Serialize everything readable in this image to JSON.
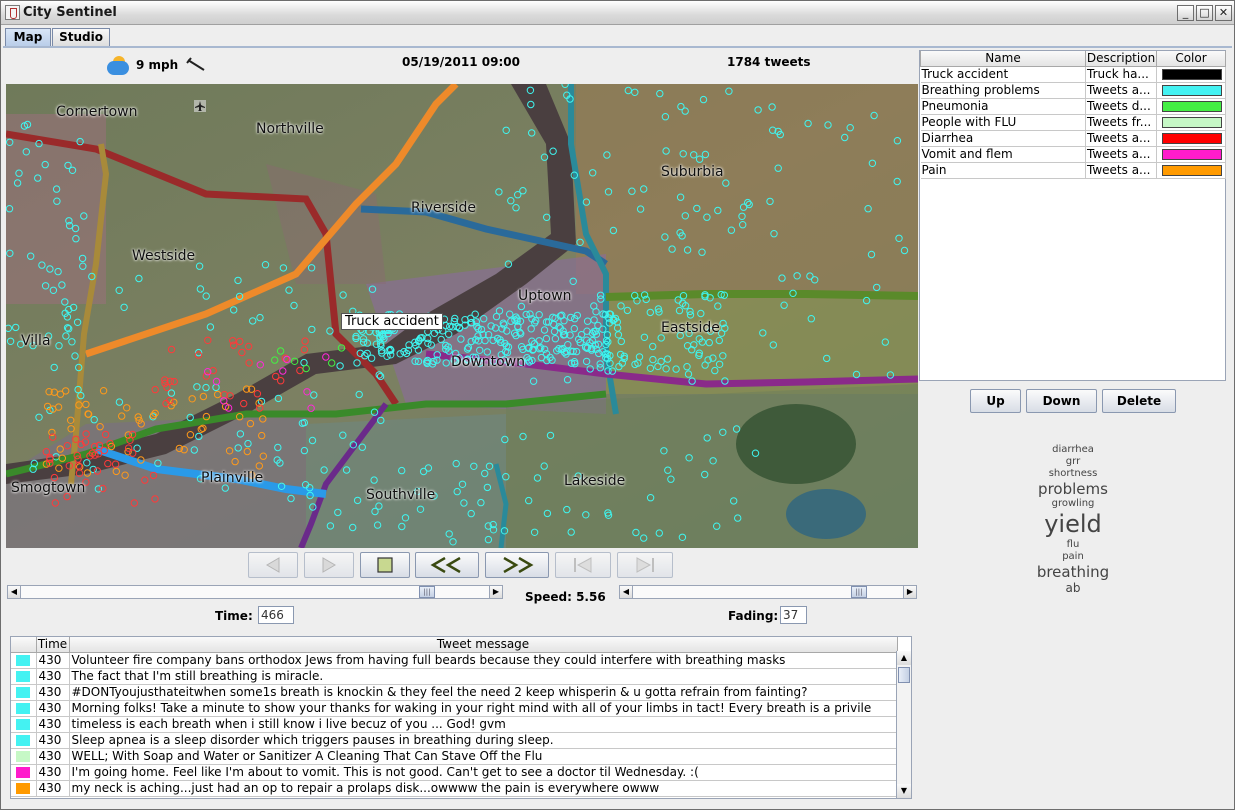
{
  "window": {
    "title": "City Sentinel"
  },
  "tabs": [
    {
      "label": "Map"
    },
    {
      "label": "Studio"
    }
  ],
  "status": {
    "wind": "9 mph",
    "datetime": "05/19/2011 09:00",
    "tweets": "1784 tweets"
  },
  "map": {
    "labels": [
      "Cornertown",
      "Northville",
      "Suburbia",
      "Riverside",
      "Westside",
      "Uptown",
      "Eastside",
      "Villa",
      "Downtown",
      "Plainville",
      "Smogtown",
      "Southville",
      "Lakeside"
    ],
    "highlight_label": "Truck accident",
    "dot_colors": {
      "cyan": "#3ff6f0",
      "orange": "#ff9a1a",
      "red": "#ff3a3a",
      "magenta": "#ff2ad8",
      "green": "#44f044"
    }
  },
  "controls": {
    "speed": "Speed: 5.56",
    "time_label": "Time:",
    "time_value": "466",
    "fading_label": "Fading:",
    "fading_value": "37",
    "time_slider": 0.88,
    "fading_slider": 0.86
  },
  "legend": {
    "headers": [
      "Name",
      "Description",
      "Color"
    ],
    "rows": [
      {
        "name": "Truck accident",
        "desc": "Truck ha...",
        "color": "#000000"
      },
      {
        "name": "Breathing problems",
        "desc": "Tweets a...",
        "color": "#44f2f2"
      },
      {
        "name": "Pneumonia",
        "desc": "Tweets d...",
        "color": "#44ee44"
      },
      {
        "name": "People with FLU",
        "desc": "Tweets fr...",
        "color": "#c6f8c6"
      },
      {
        "name": "Diarrhea",
        "desc": "Tweets a...",
        "color": "#ff0000"
      },
      {
        "name": "Vomit and flem",
        "desc": "Tweets a...",
        "color": "#ff1ccc"
      },
      {
        "name": "Pain",
        "desc": "Tweets a...",
        "color": "#ff9a00"
      }
    ],
    "buttons": [
      "Up",
      "Down",
      "Delete"
    ]
  },
  "wordcloud": [
    {
      "word": "diarrhea",
      "size": 10
    },
    {
      "word": "grr",
      "size": 10
    },
    {
      "word": "shortness",
      "size": 10
    },
    {
      "word": "problems",
      "size": 15
    },
    {
      "word": "growling",
      "size": 10
    },
    {
      "word": "yield",
      "size": 24
    },
    {
      "word": "flu",
      "size": 10
    },
    {
      "word": "pain",
      "size": 10
    },
    {
      "word": "breathing",
      "size": 15
    },
    {
      "word": "ab",
      "size": 12
    }
  ],
  "tweets": {
    "headers": [
      "",
      "Time",
      "Tweet message"
    ],
    "rows": [
      {
        "color": "#44f2f2",
        "time": "430",
        "msg": "Volunteer fire company bans orthodox Jews from having full beards because they could interfere with breathing masks"
      },
      {
        "color": "#44f2f2",
        "time": "430",
        "msg": "The fact that I'm still breathing is miracle."
      },
      {
        "color": "#44f2f2",
        "time": "430",
        "msg": "#DONTyoujusthateitwhen some1s breath is knockin & they feel the need 2 keep whisperin & u gotta refrain from fainting?"
      },
      {
        "color": "#44f2f2",
        "time": "430",
        "msg": "Morning folks! Take a minute to show your thanks for waking in your right mind with all of your limbs in tact! Every breath is a privile"
      },
      {
        "color": "#44f2f2",
        "time": "430",
        "msg": "timeless is each breath when i still know i live becuz of you ... God! gvm"
      },
      {
        "color": "#44f2f2",
        "time": "430",
        "msg": "Sleep apnea is a sleep disorder which triggers pauses in breathing during sleep."
      },
      {
        "color": "#c6f8c6",
        "time": "430",
        "msg": "WELL; With Soap and Water or Sanitizer A Cleaning That Can Stave Off the Flu"
      },
      {
        "color": "#ff1ccc",
        "time": "430",
        "msg": "I'm going home. Feel like I'm about to vomit. This is not good. Can't get to see a doctor til Wednesday. :("
      },
      {
        "color": "#ff9a00",
        "time": "430",
        "msg": "my neck is aching...just had an op to repair a prolaps disk...owwww the pain is everywhere owww"
      }
    ]
  }
}
